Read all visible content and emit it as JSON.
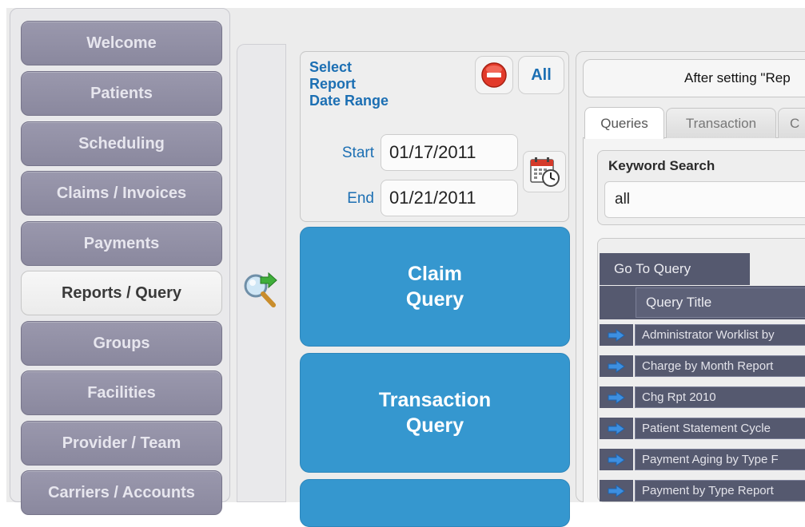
{
  "sidebar": {
    "items": [
      {
        "label": "Welcome",
        "active": false
      },
      {
        "label": "Patients",
        "active": false
      },
      {
        "label": "Scheduling",
        "active": false
      },
      {
        "label": "Claims / Invoices",
        "active": false
      },
      {
        "label": "Payments",
        "active": false
      },
      {
        "label": "Reports / Query",
        "active": true
      },
      {
        "label": "Groups",
        "active": false
      },
      {
        "label": "Facilities",
        "active": false
      },
      {
        "label": "Provider / Team",
        "active": false
      },
      {
        "label": "Carriers / Accounts",
        "active": false
      }
    ]
  },
  "date_range": {
    "title_line1": "Select",
    "title_line2": "Report",
    "title_line3": "Date Range",
    "all_label": "All",
    "start_label": "Start",
    "start_value": "01/17/2011",
    "end_label": "End",
    "end_value": "01/21/2011"
  },
  "query_buttons": {
    "claim_line1": "Claim",
    "claim_line2": "Query",
    "transaction_line1": "Transaction",
    "transaction_line2": "Query"
  },
  "right_panel": {
    "notice": "After setting \"Rep",
    "tabs": [
      "Queries",
      "Transaction",
      "C"
    ],
    "keyword_label": "Keyword Search",
    "keyword_value": "all",
    "goto_label": "Go To Query",
    "column_title": "Query Title",
    "rows": [
      "Administrator Worklist by",
      "Charge by Month Report",
      "Chg Rpt 2010",
      "Patient Statement Cycle",
      "Payment Aging by Type F",
      "Payment by Type Report"
    ]
  },
  "colors": {
    "nav_button": "#8f8da3",
    "accent_blue": "#3597cf",
    "label_blue": "#1c6fb3",
    "grid_dark": "#55596f"
  }
}
